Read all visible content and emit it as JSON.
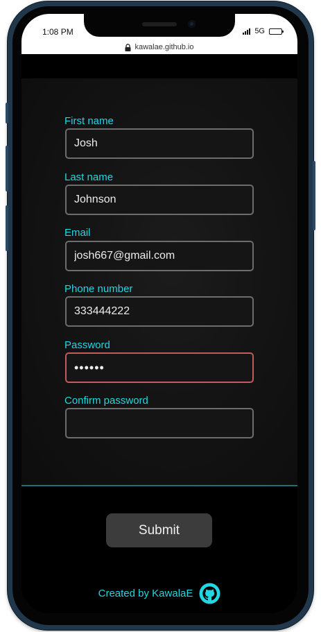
{
  "status_bar": {
    "time": "1:08 PM",
    "network": "5G"
  },
  "browser": {
    "url": "kawalae.github.io"
  },
  "form": {
    "fields": [
      {
        "label": "First name",
        "value": "Josh",
        "state": "normal"
      },
      {
        "label": "Last name",
        "value": "Johnson",
        "state": "normal"
      },
      {
        "label": "Email",
        "value": "josh667@gmail.com",
        "state": "normal"
      },
      {
        "label": "Phone number",
        "value": "333444222",
        "state": "normal"
      },
      {
        "label": "Password",
        "value": "••••••",
        "state": "invalid"
      },
      {
        "label": "Confirm password",
        "value": "",
        "state": "normal"
      }
    ],
    "submit_label": "Submit"
  },
  "footer": {
    "credit": "Created by KawalaE",
    "icon": "github-icon"
  },
  "colors": {
    "accent": "#22d6e2",
    "input_border": "#6d6d6d",
    "invalid_border": "#c55b5b",
    "button_bg": "#3c3c3c",
    "background": "#000000"
  }
}
